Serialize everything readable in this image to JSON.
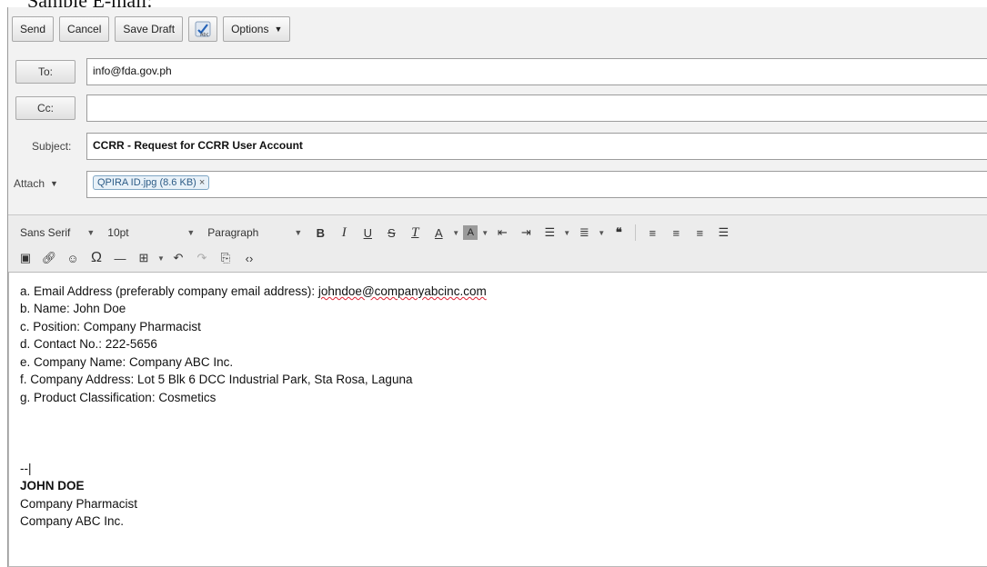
{
  "caption": "Sample E-mail:",
  "toolbar": {
    "send": "Send",
    "cancel": "Cancel",
    "save_draft": "Save Draft",
    "spell_icon": "spellcheck-icon",
    "options": "Options"
  },
  "header": {
    "to_label": "To:",
    "to_value": "info@fda.gov.ph",
    "cc_label": "Cc:",
    "cc_value": "",
    "subject_label": "Subject:",
    "subject_value": "CCRR - Request for CCRR User Account",
    "attach_label": "Attach",
    "attachment": "QPIRA ID.jpg (8.6 KB)"
  },
  "editor_toolbar": {
    "font": "Sans Serif",
    "size": "10pt",
    "block": "Paragraph"
  },
  "body": {
    "lines": [
      "a. Email Address (preferably company email address): ",
      "b. Name: John Doe",
      "c. Position: Company Pharmacist",
      "d. Contact No.: 222-5656",
      "e. Company Name: Company ABC Inc.",
      "f. Company Address: Lot 5 Blk 6 DCC Industrial Park, Sta Rosa, Laguna",
      "g. Product Classification: Cosmetics"
    ],
    "email_value": "johndoe@companyabcinc.com",
    "sig_sep": "--|",
    "sig_name": "JOHN DOE",
    "sig_position": "Company Pharmacist",
    "sig_company": "Company ABC Inc."
  },
  "colors": {
    "accent": "#2c5b86",
    "spell_error": "#d22233"
  }
}
